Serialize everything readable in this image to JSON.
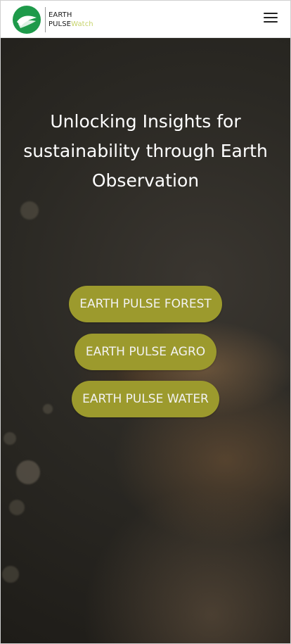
{
  "brand": {
    "line1": "EARTH",
    "line2_main": "PULSE",
    "line2_accent": "Watch",
    "colors": {
      "green": "#1e9a4a",
      "accent": "#c6d36a"
    }
  },
  "header": {
    "menu_icon": "hamburger-menu-icon"
  },
  "hero": {
    "title": "Unlocking Insights for sustainability through Earth Observation",
    "buttons": [
      {
        "label": "EARTH PULSE FOREST"
      },
      {
        "label": "EARTH PULSE AGRO"
      },
      {
        "label": "EARTH PULSE WATER"
      }
    ],
    "button_color": "#9c9a2d"
  }
}
